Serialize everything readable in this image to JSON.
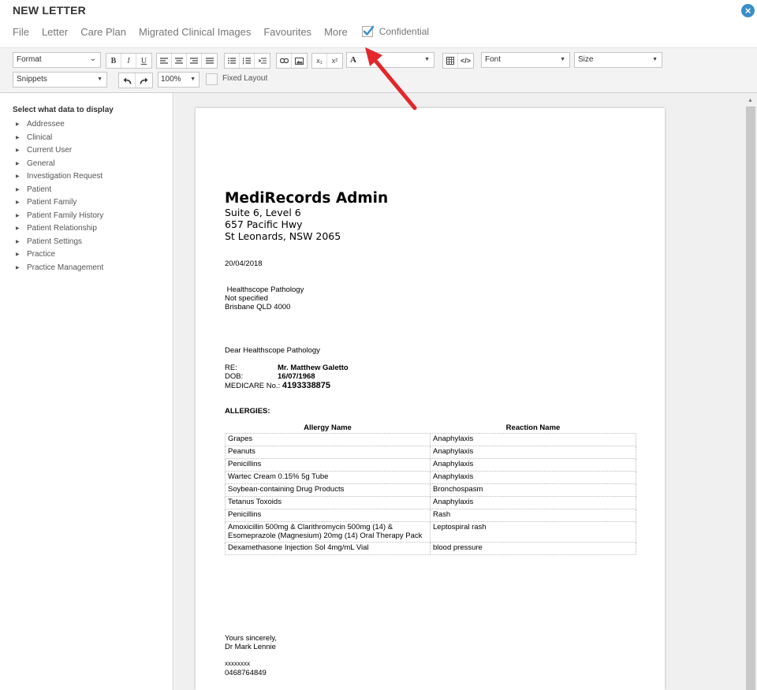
{
  "header": {
    "title": "NEW LETTER"
  },
  "menu": {
    "items": [
      "File",
      "Letter",
      "Care Plan",
      "Migrated Clinical Images",
      "Favourites",
      "More"
    ],
    "confidential_label": "Confidential",
    "confidential_checked": true
  },
  "toolbar": {
    "format_select": "Format",
    "snippets_select": "Snippets",
    "zoom": "100%",
    "fixed_layout_label": "Fixed Layout",
    "font_select": "Font",
    "size_select": "Size",
    "bold": "B",
    "italic": "I",
    "underline": "U",
    "text_color": "A",
    "subscript": "x₁",
    "superscript": "x²"
  },
  "sidebar": {
    "heading": "Select what data to display",
    "items": [
      "Addressee",
      "Clinical",
      "Current User",
      "General",
      "Investigation Request",
      "Patient",
      "Patient Family",
      "Patient Family History",
      "Patient Relationship",
      "Patient Settings",
      "Practice",
      "Practice Management"
    ]
  },
  "letter": {
    "sender_name": "MediRecords Admin",
    "sender_lines": [
      "Suite 6, Level 6",
      "657 Pacific Hwy",
      "St Leonards, NSW 2065"
    ],
    "date": "20/04/2018",
    "recipient_lines": [
      " Healthscope Pathology",
      "Not specified",
      "Brisbane QLD 4000"
    ],
    "salutation": "Dear Healthscope Pathology",
    "re_label": "RE:",
    "re_value": "Mr. Matthew Galetto",
    "dob_label": "DOB:",
    "dob_value": "16/07/1968",
    "medicare_label": "MEDICARE No.:",
    "medicare_value": "4193338875",
    "allergies_heading": "ALLERGIES:",
    "allergy_headers": [
      "Allergy Name",
      "Reaction Name"
    ],
    "allergies": [
      [
        "Grapes",
        "Anaphylaxis"
      ],
      [
        "Peanuts",
        "Anaphylaxis"
      ],
      [
        "Penicillins",
        "Anaphylaxis"
      ],
      [
        "Wartec Cream 0.15% 5g Tube",
        "Anaphylaxis"
      ],
      [
        "Soybean-containing Drug Products",
        "Bronchospasm"
      ],
      [
        "Tetanus Toxoids",
        "Anaphylaxis"
      ],
      [
        "Penicillins",
        "Rash"
      ],
      [
        "Amoxicillin 500mg & Clarithromycin 500mg (14) & Esomeprazole (Magnesium) 20mg (14) Oral Therapy Pack",
        "Leptospiral rash"
      ],
      [
        "Dexamethasone Injection Sol 4mg/mL Vial",
        "blood pressure"
      ]
    ],
    "closing": "Yours sincerely,",
    "signer": "Dr Mark Lennie",
    "signer_provider": "xxxxxxxx",
    "signer_phone": "0468764849"
  },
  "colors": {
    "accent": "#3a8fc8",
    "annotation_arrow": "#e3262b"
  }
}
